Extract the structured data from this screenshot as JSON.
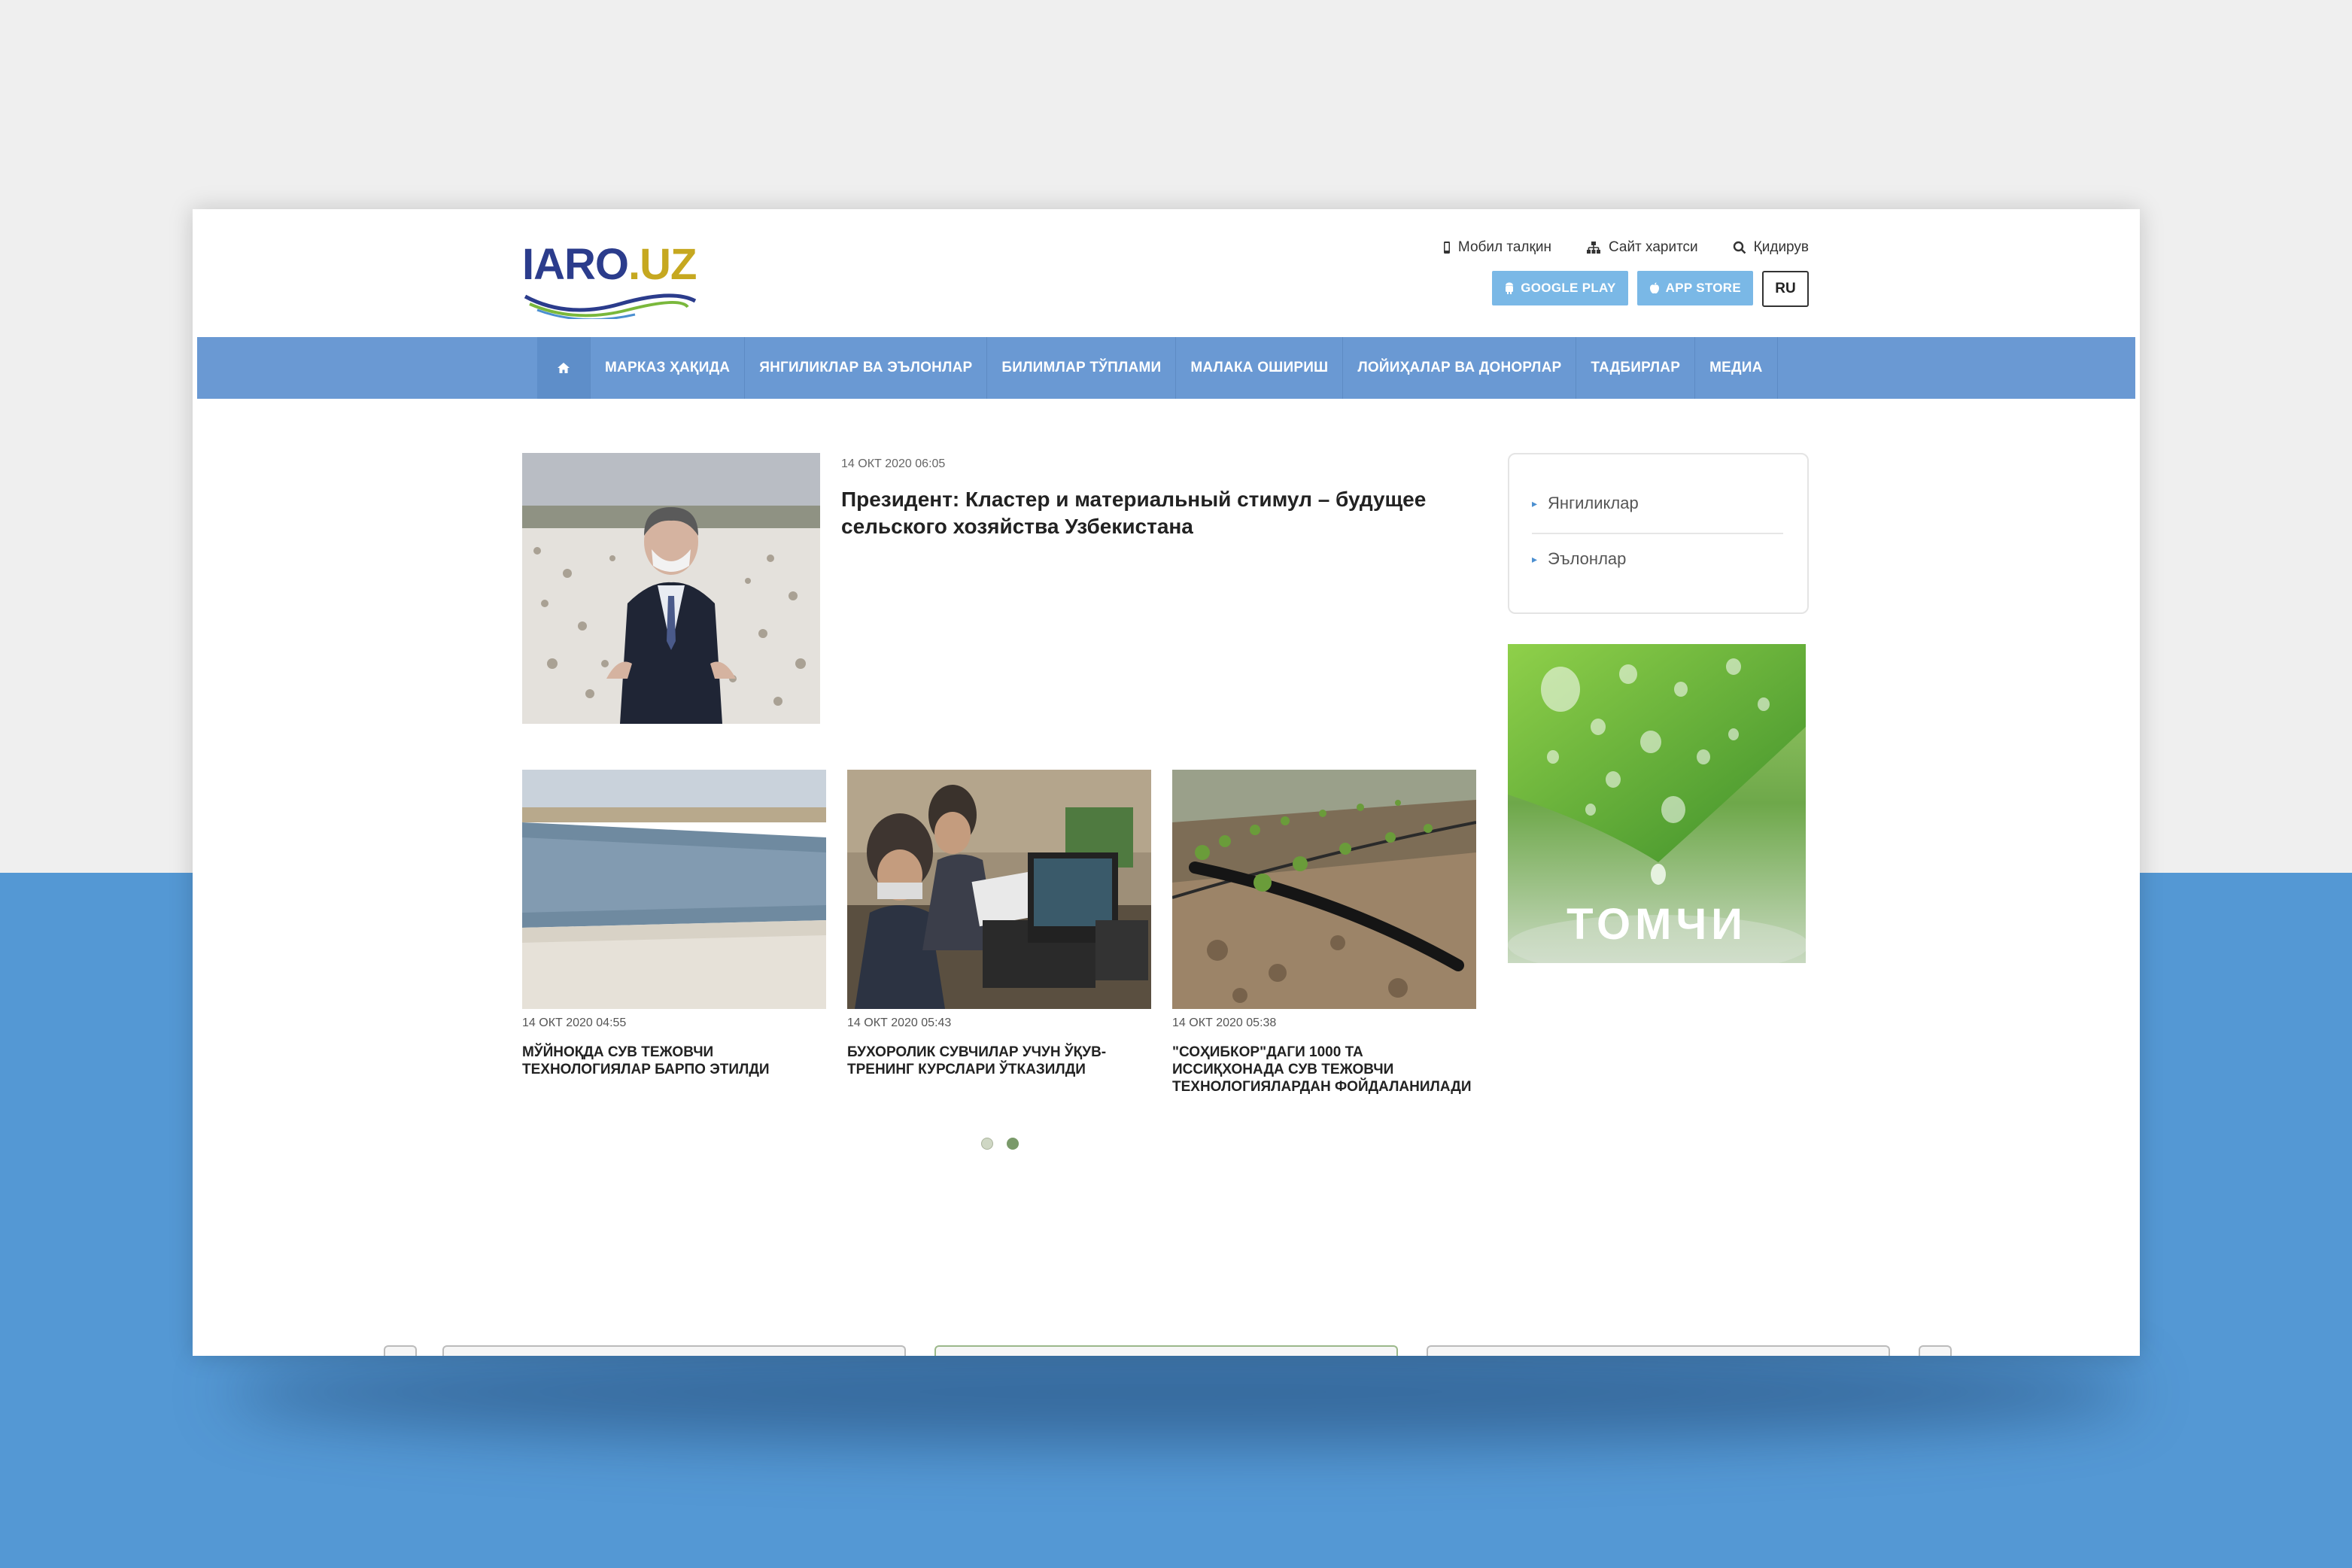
{
  "logo": {
    "text_main": "IARO",
    "text_domain": ".UZ"
  },
  "header": {
    "links": [
      {
        "label": "Мобил талқин",
        "icon": "mobile-icon"
      },
      {
        "label": "Сайт харитси",
        "icon": "sitemap-icon"
      },
      {
        "label": "Қидирув",
        "icon": "search-icon"
      }
    ],
    "google_play": "GOOGLE PLAY",
    "app_store": "APP STORE",
    "lang": "RU"
  },
  "nav": {
    "home_icon": "home-icon",
    "items": [
      "МАРКАЗ ҲАҚИДА",
      "ЯНГИЛИКЛАР ВА ЭЪЛОНЛАР",
      "БИЛИМЛАР ТЎПЛАМИ",
      "МАЛАКА ОШИРИШ",
      "ЛОЙИҲАЛАР ВА ДОНОРЛАР",
      "ТАДБИРЛАР",
      "МЕДИА"
    ]
  },
  "featured": {
    "date": "14 ОКТ 2020 06:05",
    "title": "Президент: Кластер и материальный стимул – будущее сельского хозяйства Узбекистана"
  },
  "cards": [
    {
      "date": "14 ОКТ 2020 04:55",
      "title": "МЎЙНОҚДА СУВ ТЕЖОВЧИ ТЕХНОЛОГИЯЛАР БАРПО ЭТИЛДИ"
    },
    {
      "date": "14 ОКТ 2020 05:43",
      "title": "БУХОРОЛИК СУВЧИЛАР УЧУН ЎҚУВ-ТРЕНИНГ КУРСЛАРИ ЎТКАЗИЛДИ"
    },
    {
      "date": "14 ОКТ 2020 05:38",
      "title": "\"СОҲИБКОР\"ДАГИ 1000 ТА ИССИҚХОНАДА СУВ ТЕЖОВЧИ ТЕХНОЛОГИЯЛАРДАН ФОЙДАЛАНИЛАДИ"
    }
  ],
  "sidebar": {
    "items": [
      "Янгиликлар",
      "Эълонлар"
    ],
    "banner_text": "ТОМЧИ"
  },
  "colors": {
    "nav": "#6a99d3",
    "store_button": "#7ab8e6",
    "bg_bottom": "#5498d4"
  }
}
